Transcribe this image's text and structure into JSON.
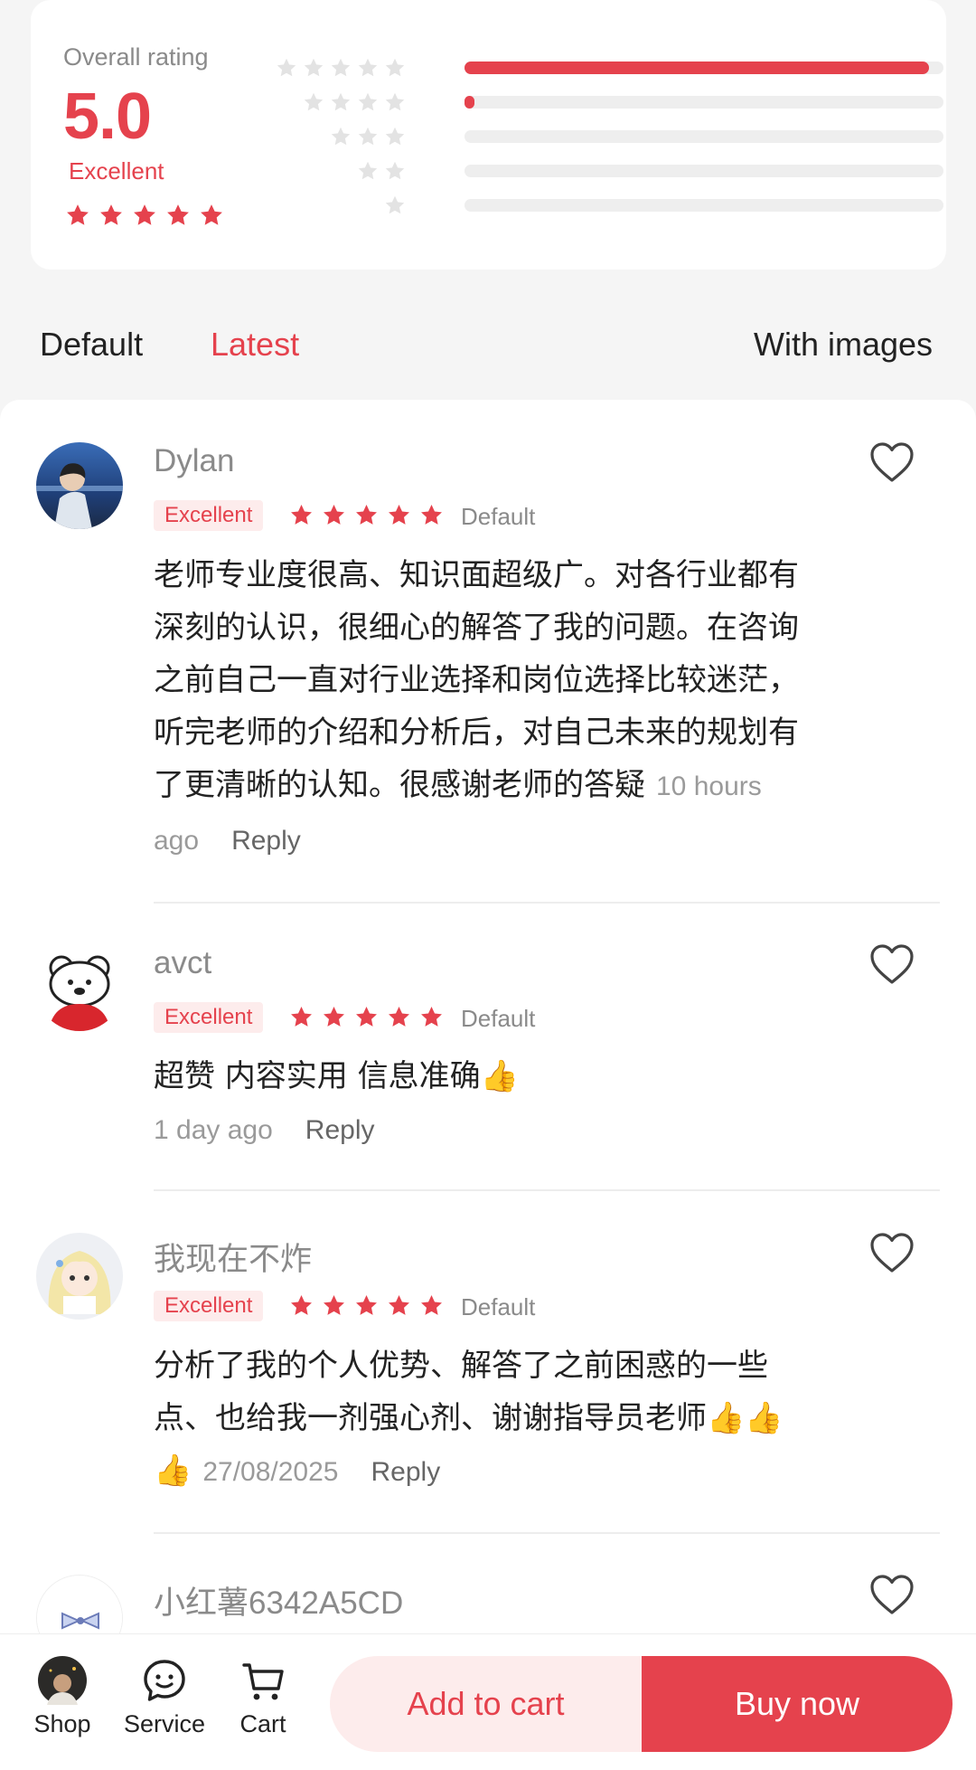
{
  "colors": {
    "accent": "#e5424d",
    "accent_light": "#fdecec",
    "star_empty": "#e3e3e3"
  },
  "summary": {
    "label": "Overall rating",
    "score": "5.0",
    "word": "Excellent",
    "distribution": [
      {
        "stars": 5,
        "fraction": 0.97
      },
      {
        "stars": 4,
        "fraction": 0.02
      },
      {
        "stars": 3,
        "fraction": 0
      },
      {
        "stars": 2,
        "fraction": 0
      },
      {
        "stars": 1,
        "fraction": 0
      }
    ]
  },
  "tabs": [
    {
      "label": "Default",
      "active": false
    },
    {
      "label": "Latest",
      "active": true
    },
    {
      "label": "With images",
      "active": false
    }
  ],
  "reviews": [
    {
      "name": "Dylan",
      "badge": "Excellent",
      "type": "Default",
      "text": "老师专业度很高、知识面超级广。对各行业都有深刻的认识，很细心的解答了我的问题。在咨询之前自己一直对行业选择和岗位选择比较迷茫，听完老师的介绍和分析后，对自己未来的规划有了更清晰的认知。很感谢老师的答疑",
      "time": "10 hours ago",
      "reply": "Reply"
    },
    {
      "name": "avct",
      "badge": "Excellent",
      "type": "Default",
      "text": "超赞 内容实用 信息准确👍",
      "time": "1 day ago",
      "reply": "Reply"
    },
    {
      "name": "我现在不炸",
      "badge": "Excellent",
      "type": "Default",
      "text": "分析了我的个人优势、解答了之前困惑的一些点、也给我一剂强心剂、谢谢指导员老师👍👍👍",
      "time": "27/08/2025",
      "reply": "Reply"
    },
    {
      "name": "小红薯6342A5CD"
    }
  ],
  "bottom_nav": [
    {
      "label": "Shop",
      "icon": "shop-avatar-icon"
    },
    {
      "label": "Service",
      "icon": "service-chat-icon"
    },
    {
      "label": "Cart",
      "icon": "cart-icon"
    }
  ],
  "actions": {
    "add_to_cart": "Add to cart",
    "buy_now": "Buy now"
  }
}
